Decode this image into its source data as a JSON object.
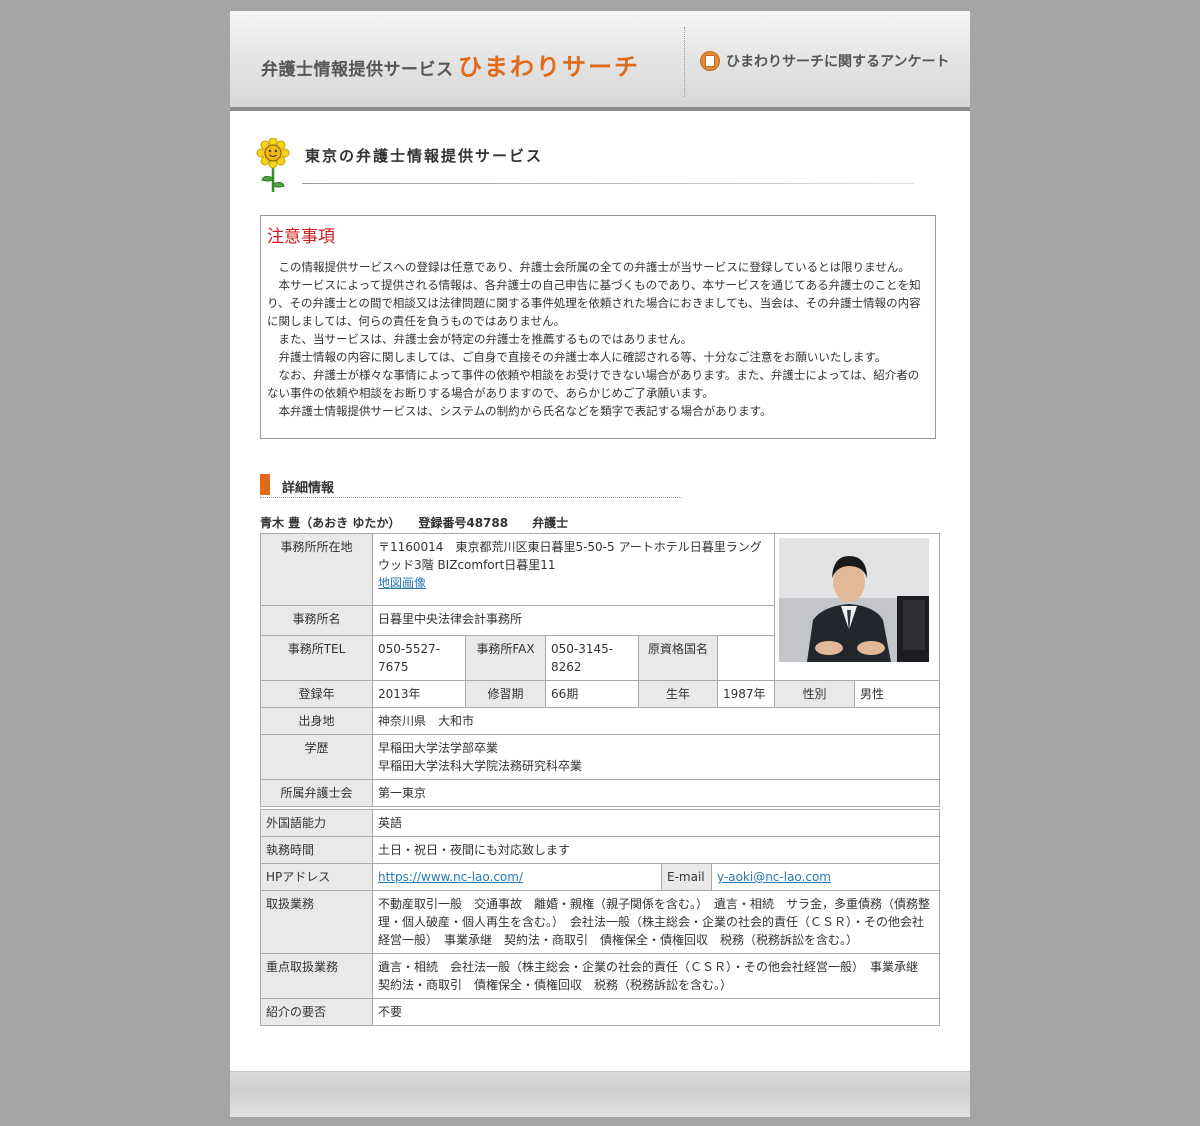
{
  "header": {
    "site_sub": "弁護士情報提供サービス",
    "site_name": "ひまわりサーチ",
    "survey_link": "ひまわりサーチに関するアンケート"
  },
  "page_title": "東京の弁護士情報提供サービス",
  "notice": {
    "title": "注意事項",
    "paragraphs": [
      "この情報提供サービスへの登録は任意であり、弁護士会所属の全ての弁護士が当サービスに登録しているとは限りません。",
      "本サービスによって提供される情報は、各弁護士の自己申告に基づくものであり、本サービスを通じてある弁護士のことを知り、その弁護士との間で相談又は法律問題に関する事件処理を依頼された場合におきましても、当会は、その弁護士情報の内容に関しましては、何らの責任を負うものではありません。",
      "また、当サービスは、弁護士会が特定の弁護士を推薦するものではありません。",
      "弁護士情報の内容に関しましては、ご自身で直接その弁護士本人に確認される等、十分なご注意をお願いいたします。",
      "なお、弁護士が様々な事情によって事件の依頼や相談をお受けできない場合があります。また、弁護士によっては、紹介者のない事件の依頼や相談をお断りする場合がありますので、あらかじめご了承願います。",
      "本弁護士情報提供サービスは、システムの制約から氏名などを類字で表記する場合があります。"
    ]
  },
  "detail": {
    "heading": "詳細情報",
    "lawyer_line": "青木 豊（あおき ゆたか）　　登録番号48788　　弁護士"
  },
  "table1": {
    "office_address_label": "事務所所在地",
    "office_address": "〒1160014　東京都荒川区東日暮里5-50-5 アートホテル日暮里ラングウッド3階 BIZcomfort日暮里11",
    "map_link": "地図画像",
    "office_name_label": "事務所名",
    "office_name": "日暮里中央法律会計事務所",
    "tel_label": "事務所TEL",
    "tel": "050-5527-7675",
    "fax_label": "事務所FAX",
    "fax": "050-3145-8262",
    "orig_qual_label": "原資格国名",
    "orig_qual": "",
    "reg_year_label": "登録年",
    "reg_year": "2013年",
    "training_label": "修習期",
    "training": "66期",
    "birth_year_label": "生年",
    "birth_year": "1987年",
    "gender_label": "性別",
    "gender": "男性",
    "birthplace_label": "出身地",
    "birthplace": "神奈川県　大和市",
    "education_label": "学歴",
    "education_1": "早稲田大学法学部卒業",
    "education_2": "早稲田大学法科大学院法務研究科卒業",
    "bar_label": "所属弁護士会",
    "bar": "第一東京"
  },
  "table2": {
    "language_label": "外国語能力",
    "language": "英語",
    "hours_label": "執務時間",
    "hours": "土日・祝日・夜間にも対応致します",
    "hp_label": "HPアドレス",
    "hp": "https://www.nc-lao.com/",
    "email_label": "E-mail",
    "email": "y-aoki@nc-lao.com",
    "practice_label": "取扱業務",
    "practice": "不動産取引一般　交通事故　離婚・親権（親子関係を含む。）　遺言・相続　サラ金，多重債務（債務整理・個人破産・個人再生を含む。）　会社法一般（株主総会・企業の社会的責任（ＣＳＲ）・その他会社経営一般）　事業承継　契約法・商取引　債権保全・債権回収　税務（税務訴訟を含む。）",
    "focus_label": "重点取扱業務",
    "focus": "遺言・相続　会社法一般（株主総会・企業の社会的責任（ＣＳＲ）・その他会社経営一般）　事業承継　契約法・商取引　債権保全・債権回収　税務（税務訴訟を含む。）",
    "referral_label": "紹介の要否",
    "referral": "不要"
  },
  "colors": {
    "accent": "#e06a17",
    "notice_red": "#d0191b",
    "link": "#2a7ab0",
    "background": "#a5a5a5"
  },
  "icons": {
    "logo": "sunflower-icon",
    "survey": "document-icon"
  }
}
